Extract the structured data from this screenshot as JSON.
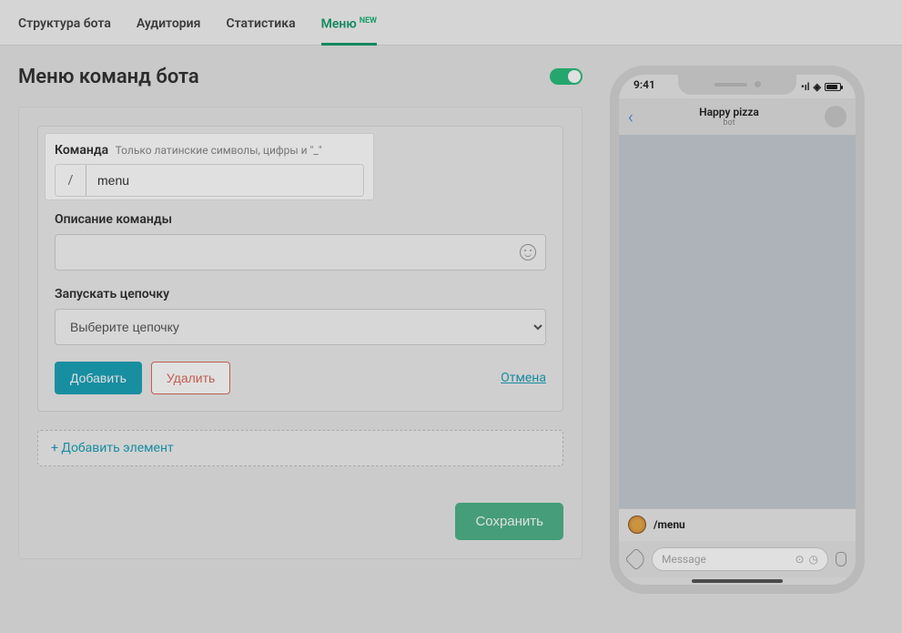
{
  "tabs": {
    "structure": "Структура бота",
    "audience": "Аудитория",
    "stats": "Статистика",
    "menu": "Меню",
    "new_badge": "NEW"
  },
  "heading": "Меню команд бота",
  "command": {
    "label": "Команда",
    "hint": "Только латинские символы, цифры и \"_\"",
    "slash": "/",
    "value": "menu"
  },
  "description": {
    "label": "Описание команды",
    "value": ""
  },
  "chain": {
    "label": "Запускать цепочку",
    "placeholder": "Выберите цепочку"
  },
  "buttons": {
    "add": "Добавить",
    "delete": "Удалить",
    "cancel": "Отмена",
    "add_element": "+ Добавить элемент",
    "save": "Сохранить"
  },
  "phone": {
    "time": "9:41",
    "title": "Happy pizza",
    "subtitle": "bot",
    "menu_command": "/menu",
    "message_placeholder": "Message"
  }
}
